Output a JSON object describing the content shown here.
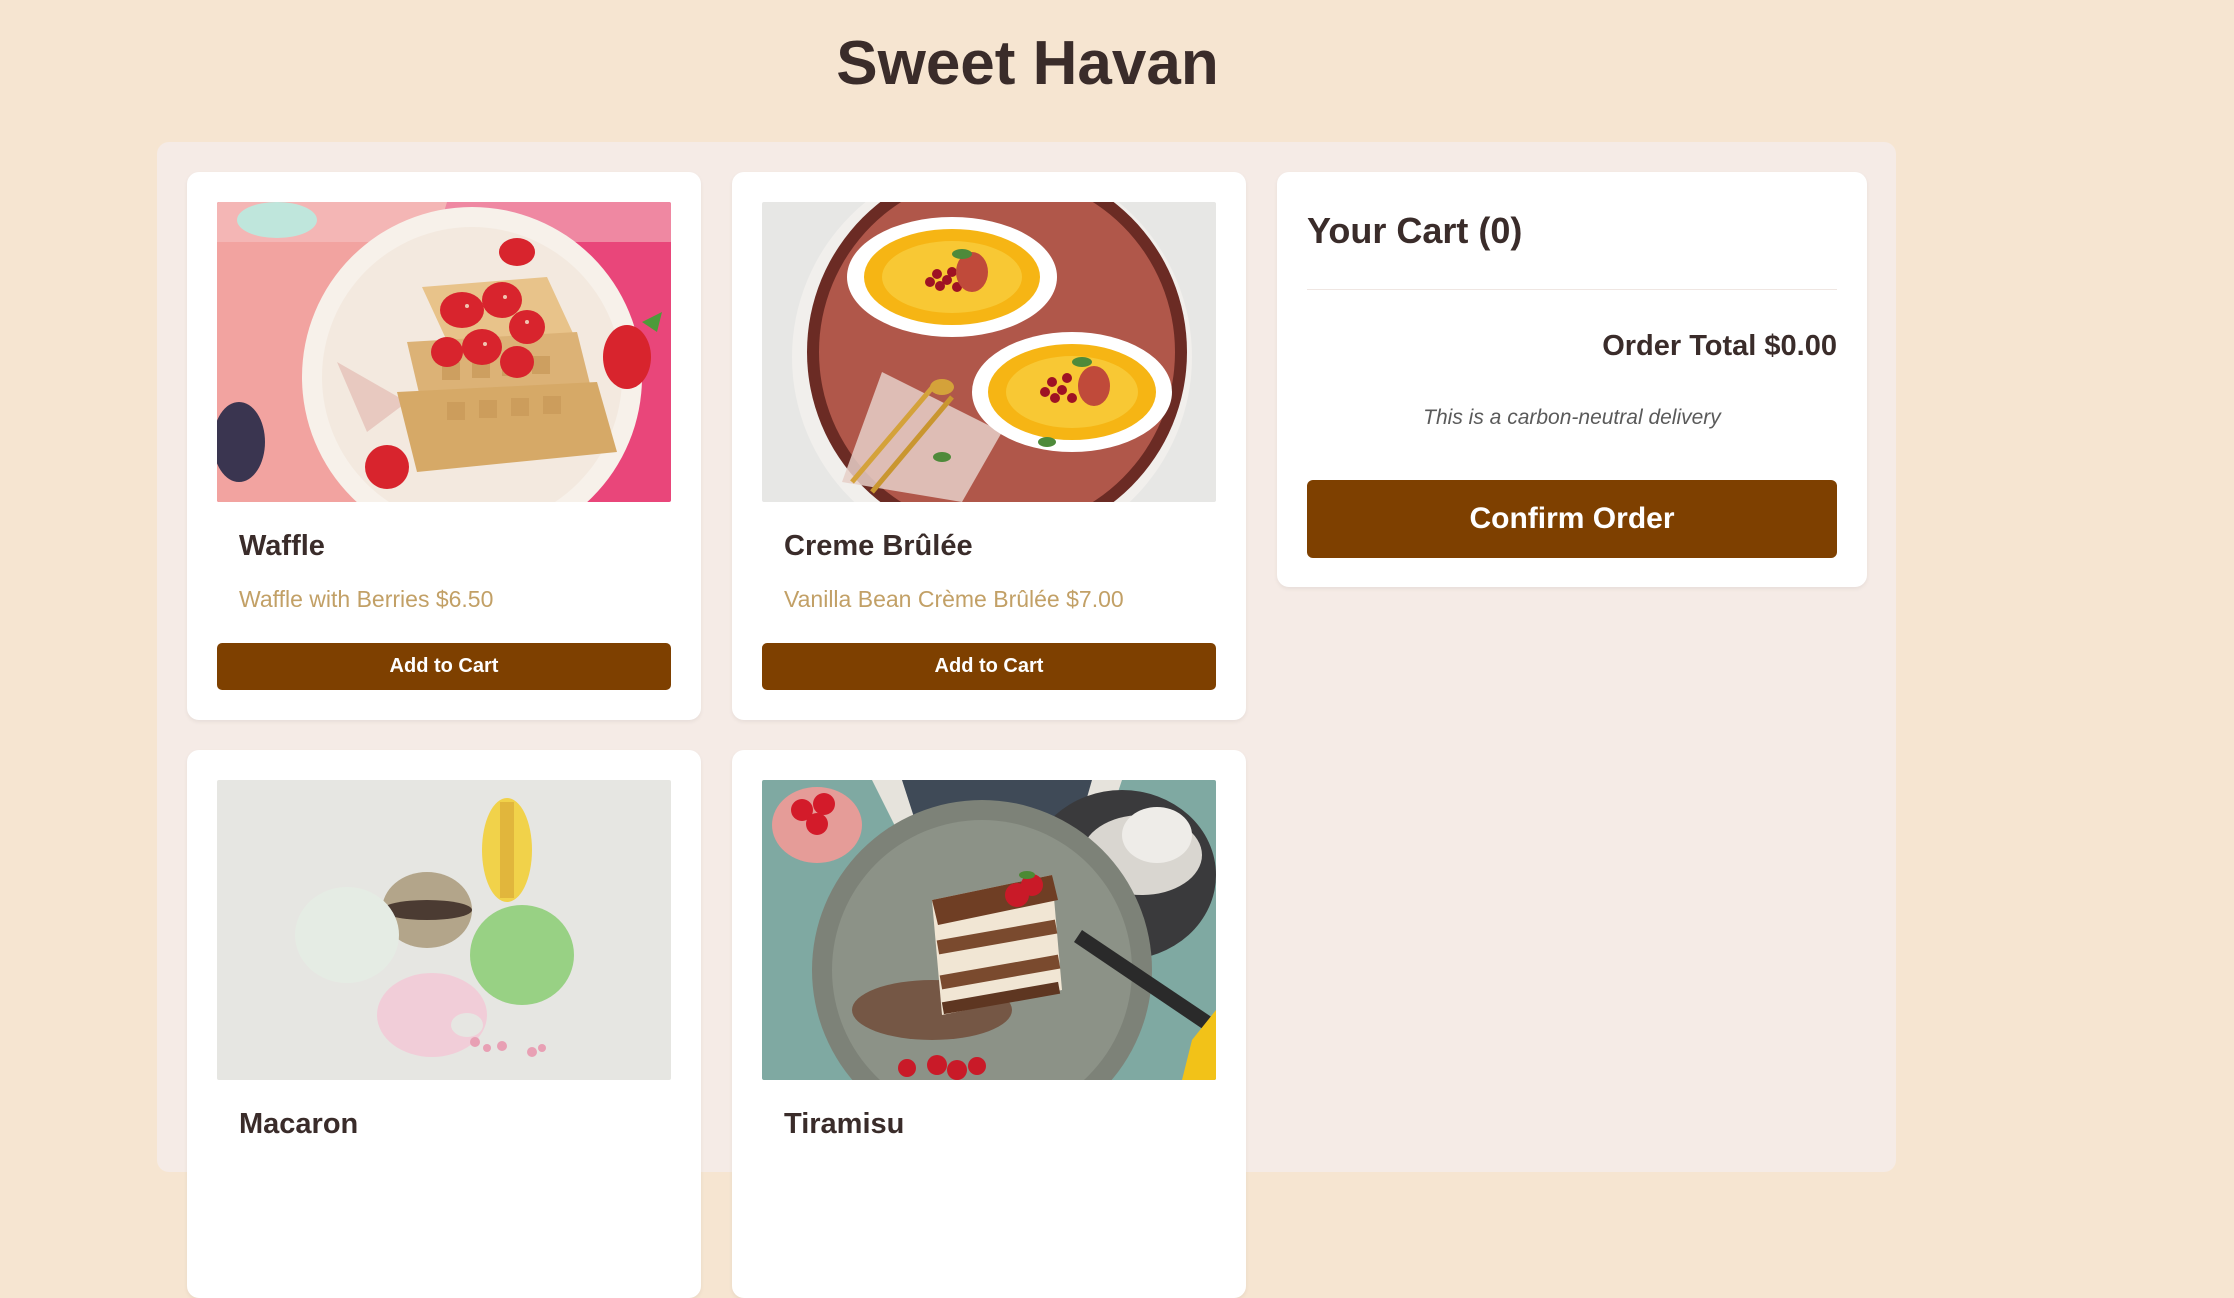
{
  "header": {
    "title": "Sweet Havan"
  },
  "products": [
    {
      "name": "Waffle",
      "description": "Waffle with Berries $6.50",
      "button_label": "Add to Cart"
    },
    {
      "name": "Creme Brûlée",
      "description": "Vanilla Bean Crème Brûlée $7.00",
      "button_label": "Add to Cart"
    },
    {
      "name": "Macaron",
      "description": "",
      "button_label": ""
    },
    {
      "name": "Tiramisu",
      "description": "",
      "button_label": ""
    }
  ],
  "cart": {
    "title": "Your Cart (0)",
    "order_total": "Order Total $0.00",
    "delivery_note": "This is a carbon-neutral delivery",
    "confirm_label": "Confirm Order"
  },
  "colors": {
    "page_background": "#f6e5d1",
    "panel_background": "#f5ebe6",
    "accent": "#7e4000",
    "price_text": "#c2a066"
  }
}
